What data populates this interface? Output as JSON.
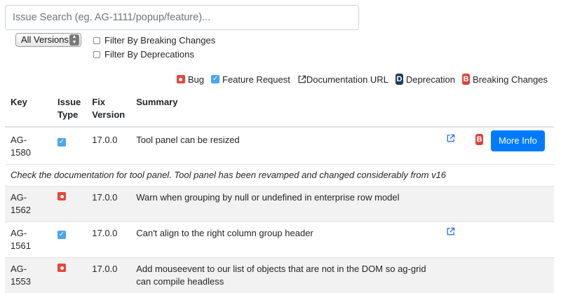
{
  "search": {
    "placeholder": "Issue Search (eg. AG-1111/popup/feature)..."
  },
  "version_select": {
    "selected": "All Versions"
  },
  "filters": {
    "breaking": "Filter By Breaking Changes",
    "deprecations": "Filter By Deprecations"
  },
  "legend": {
    "bug": "Bug",
    "feature": "Feature Request",
    "doc_url": "Documentation URL",
    "deprecation": "Deprecation",
    "deprecation_letter": "D",
    "breaking": "Breaking Changes",
    "breaking_letter": "B"
  },
  "table": {
    "headers": {
      "key": "Key",
      "issue_type_1": "Issue",
      "issue_type_2": "Type",
      "fix_1": "Fix",
      "fix_2": "Version",
      "summary": "Summary"
    },
    "rows": [
      {
        "key": "AG-1580",
        "type": "feature",
        "version": "17.0.0",
        "summary": "Tool panel can be resized",
        "more_info": "More Info",
        "note": "Check the documentation for tool panel. Tool panel has been revamped and changed considerably from v16"
      },
      {
        "key": "AG-1562",
        "type": "bug",
        "version": "17.0.0",
        "summary": "Warn when grouping by null or undefined in enterprise row model"
      },
      {
        "key": "AG-1561",
        "type": "feature",
        "version": "17.0.0",
        "summary": "Can't align to the right column group header"
      },
      {
        "key": "AG-1553",
        "type": "bug",
        "version": "17.0.0",
        "summary_1": "Add mouseevent to our list of objects that are not in the DOM so ag-grid",
        "summary_2": "can compile headless"
      }
    ]
  },
  "colors": {
    "bug": "#e8453c",
    "feature": "#4aa5f0",
    "deprecation": "#1f3a5c",
    "breaking": "#d9443a",
    "primary": "#007bff",
    "link": "#2a7ae2"
  },
  "icons": {
    "bug": "bug-icon",
    "feature": "feature-request-icon",
    "external": "external-link-icon",
    "deprecation": "deprecation-icon",
    "breaking": "breaking-change-icon"
  }
}
